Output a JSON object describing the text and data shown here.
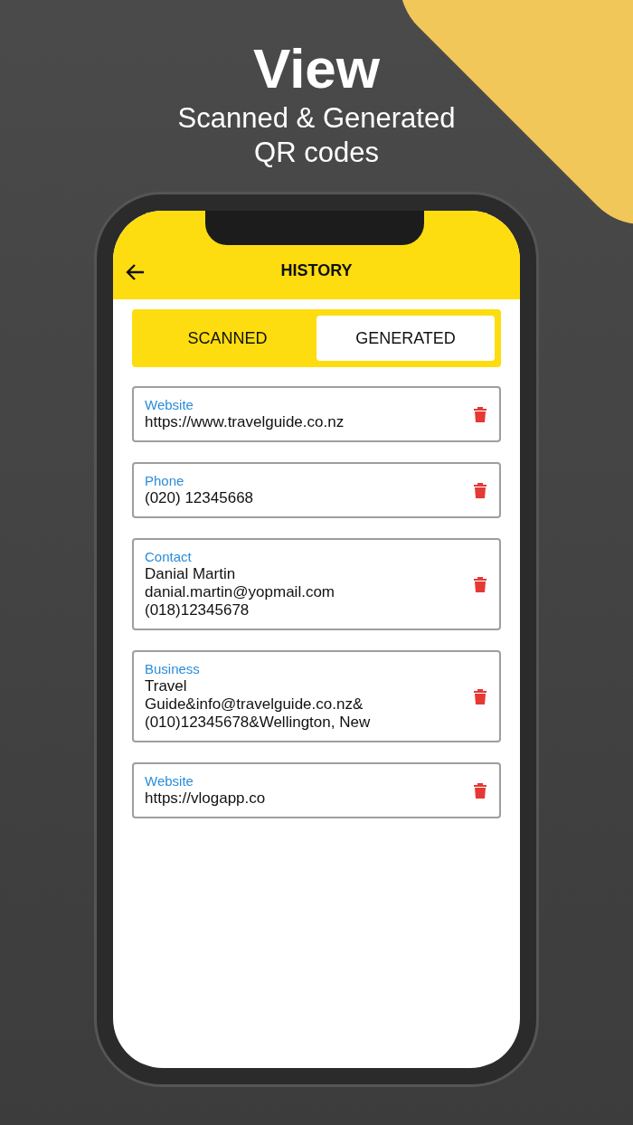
{
  "headline": {
    "title": "View",
    "subtitle_lines": [
      "Scanned & Generated",
      "QR codes"
    ]
  },
  "app_bar": {
    "title": "HISTORY"
  },
  "tabs": [
    {
      "label": "SCANNED",
      "selected": false
    },
    {
      "label": "GENERATED",
      "selected": true
    }
  ],
  "history": [
    {
      "type": "Website",
      "lines": [
        "https://www.travelguide.co.nz"
      ]
    },
    {
      "type": "Phone",
      "lines": [
        "(020) 12345668"
      ]
    },
    {
      "type": "Contact",
      "lines": [
        "Danial Martin",
        "danial.martin@yopmail.com",
        "(018)12345678"
      ]
    },
    {
      "type": "Business",
      "lines": [
        "Travel",
        "Guide&info@travelguide.co.nz&",
        "(010)12345678&Wellington, New"
      ]
    },
    {
      "type": "Website",
      "lines": [
        "https://vlogapp.co"
      ]
    }
  ]
}
